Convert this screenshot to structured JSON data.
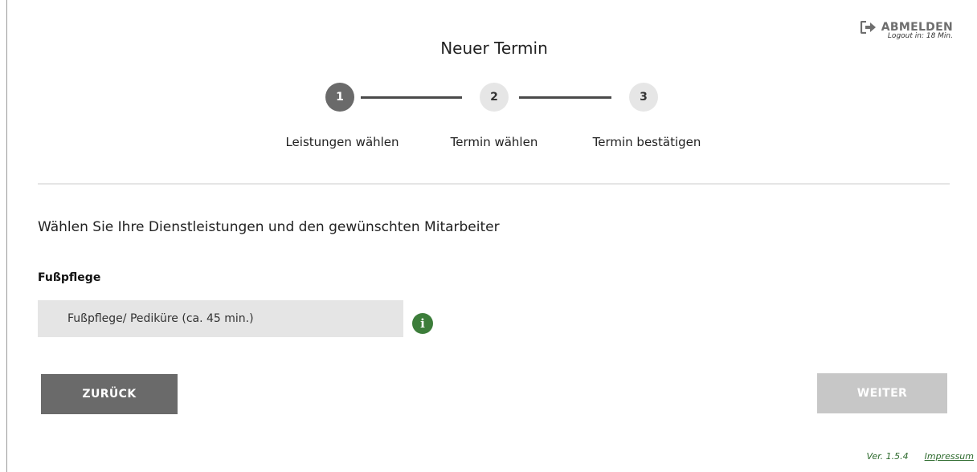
{
  "header": {
    "logout_label": "ABMELDEN",
    "logout_timer": "Logout in: 18 Min.",
    "page_title": "Neuer Termin"
  },
  "stepper": {
    "steps": [
      {
        "number": "1",
        "label": "Leistungen wählen",
        "state": "active"
      },
      {
        "number": "2",
        "label": "Termin wählen",
        "state": "inactive"
      },
      {
        "number": "3",
        "label": "Termin bestätigen",
        "state": "inactive"
      }
    ]
  },
  "main": {
    "heading": "Wählen Sie Ihre Dienstleistungen und den gewünschten Mitarbeiter",
    "category": "Fußpflege",
    "service": "Fußpflege/ Pediküre (ca. 45 min.)"
  },
  "buttons": {
    "back": "ZURÜCK",
    "next": "WEITER"
  },
  "footer": {
    "version": "Ver. 1.5.4",
    "impressum": "Impressum"
  },
  "colors": {
    "accent_green": "#3c7d3a",
    "step_active": "#6a6a6a",
    "button_disabled": "#c7c7c7"
  },
  "icons": {
    "logout": "sign-out-icon",
    "info": "info-icon"
  }
}
